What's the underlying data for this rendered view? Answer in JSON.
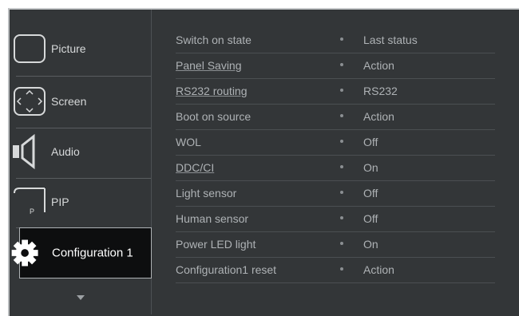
{
  "sidebar": {
    "items": [
      {
        "label": "Picture",
        "icon": "picture-icon"
      },
      {
        "label": "Screen",
        "icon": "screen-icon"
      },
      {
        "label": "Audio",
        "icon": "speaker-icon"
      },
      {
        "label": "PIP",
        "icon": "pip-icon"
      },
      {
        "label": "Configuration 1",
        "icon": "gear-icon",
        "selected": true
      }
    ],
    "more_icon": "chevron-down-icon"
  },
  "settings": [
    {
      "name": "Switch on state",
      "value": "Last status"
    },
    {
      "name": "Panel Saving",
      "value": "Action"
    },
    {
      "name": "RS232 routing",
      "value": "RS232"
    },
    {
      "name": "Boot on source",
      "value": "Action"
    },
    {
      "name": "WOL",
      "value": "Off"
    },
    {
      "name": "DDC/CI",
      "value": "On"
    },
    {
      "name": "Light sensor",
      "value": "Off"
    },
    {
      "name": "Human sensor",
      "value": "Off"
    },
    {
      "name": "Power LED light",
      "value": "On"
    },
    {
      "name": "Configuration1 reset",
      "value": "Action"
    }
  ],
  "colors": {
    "background": "#333638",
    "text": "#aeb2b5",
    "selected_bg": "#0d0e0f"
  }
}
